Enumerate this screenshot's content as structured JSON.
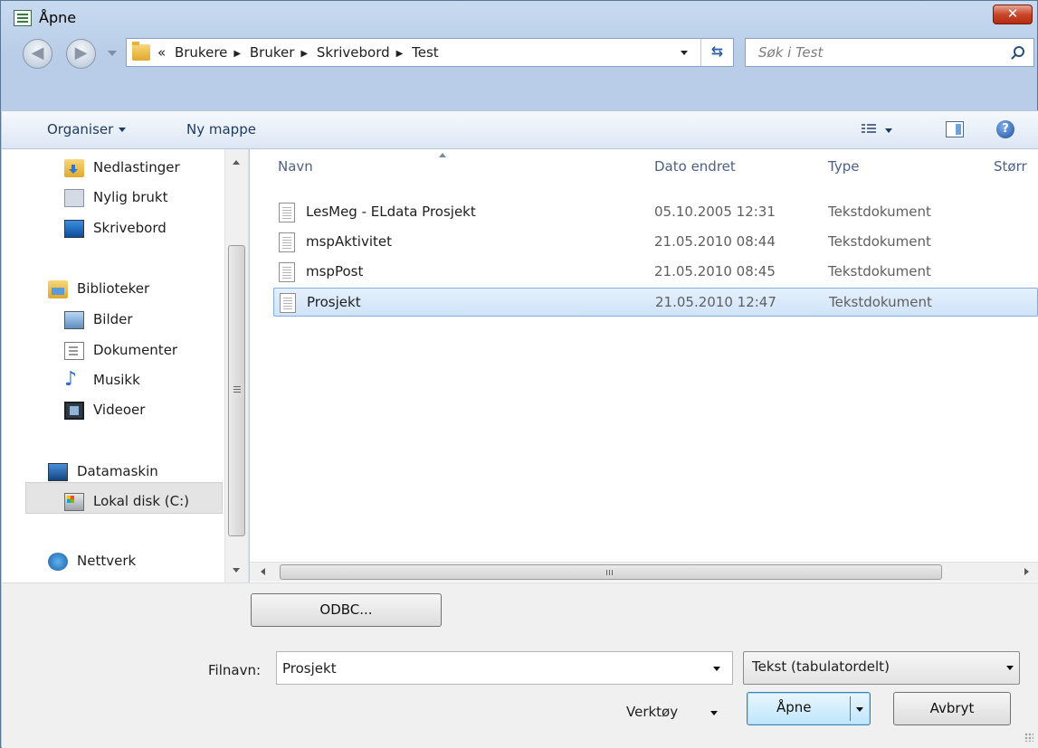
{
  "window": {
    "title": "Åpne",
    "close_label": "✕"
  },
  "address": {
    "overflow": "«",
    "crumbs": [
      "Brukere",
      "Bruker",
      "Skrivebord",
      "Test"
    ],
    "separator": "▶"
  },
  "search": {
    "placeholder": "Søk i Test"
  },
  "toolbar": {
    "organise_label": "Organiser",
    "new_folder_label": "Ny mappe",
    "help_label": "?"
  },
  "sidebar": {
    "items": [
      {
        "label": "Nedlastinger",
        "icon": "downloads-folder-icon"
      },
      {
        "label": "Nylig brukt",
        "icon": "recent-places-icon"
      },
      {
        "label": "Skrivebord",
        "icon": "desktop-icon"
      },
      {
        "label": "Biblioteker",
        "icon": "libraries-icon"
      },
      {
        "label": "Bilder",
        "icon": "pictures-icon"
      },
      {
        "label": "Dokumenter",
        "icon": "documents-icon"
      },
      {
        "label": "Musikk",
        "icon": "music-icon"
      },
      {
        "label": "Videoer",
        "icon": "videos-icon"
      },
      {
        "label": "Datamaskin",
        "icon": "computer-icon"
      },
      {
        "label": "Lokal disk (C:)",
        "icon": "local-disk-icon"
      },
      {
        "label": "Nettverk",
        "icon": "network-icon"
      }
    ],
    "selected": "Lokal disk (C:)"
  },
  "filelist": {
    "columns": [
      "Navn",
      "Dato endret",
      "Type",
      "Størr"
    ],
    "rows": [
      {
        "name": "LesMeg - ELdata Prosjekt",
        "date": "05.10.2005 12:31",
        "type": "Tekstdokument"
      },
      {
        "name": "mspAktivitet",
        "date": "21.05.2010 08:44",
        "type": "Tekstdokument"
      },
      {
        "name": "mspPost",
        "date": "21.05.2010 08:45",
        "type": "Tekstdokument"
      },
      {
        "name": "Prosjekt",
        "date": "21.05.2010 12:47",
        "type": "Tekstdokument"
      }
    ],
    "selected": "Prosjekt"
  },
  "bottom": {
    "odbc_label": "ODBC...",
    "filename_label": "Filnavn:",
    "filename_value": "Prosjekt",
    "filetype_value": "Tekst (tabulatordelt)",
    "tools_label": "Verktøy",
    "open_label": "Åpne",
    "cancel_label": "Avbryt"
  },
  "colors": {
    "selection_bg": "#cfe4fa",
    "selection_border": "#84acdd",
    "close_button": "#c7472b"
  }
}
